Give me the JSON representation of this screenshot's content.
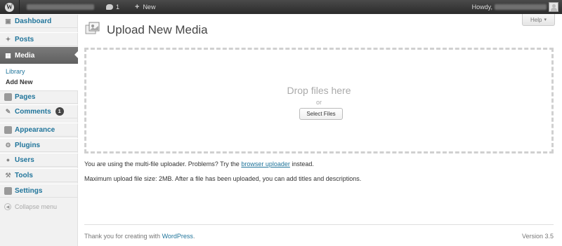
{
  "adminbar": {
    "logo": "W",
    "comment_count": "1",
    "new_label": "New",
    "howdy": "Howdy,"
  },
  "sidebar": {
    "dashboard": "Dashboard",
    "posts": "Posts",
    "media": "Media",
    "media_sub": [
      "Library",
      "Add New"
    ],
    "pages": "Pages",
    "comments": "Comments",
    "comments_badge": "1",
    "appearance": "Appearance",
    "plugins": "Plugins",
    "users": "Users",
    "tools": "Tools",
    "settings": "Settings",
    "collapse": "Collapse menu"
  },
  "page": {
    "title": "Upload New Media",
    "help": "Help",
    "drop_text": "Drop files here",
    "or_text": "or",
    "select_files": "Select Files",
    "info_prefix": "You are using the multi-file uploader. Problems? Try the",
    "info_link": "browser uploader",
    "info_suffix": "instead.",
    "max_size": "Maximum upload file size: 2MB. After a file has been uploaded, you can add titles and descriptions."
  },
  "footer": {
    "thanks_prefix": "Thank you for creating with",
    "thanks_link": "WordPress",
    "thanks_suffix": ".",
    "version": "Version 3.5"
  },
  "colors": {
    "link": "#21759b",
    "adminbar": "#2b2b2b",
    "active_menu": "#6d6d6d"
  }
}
